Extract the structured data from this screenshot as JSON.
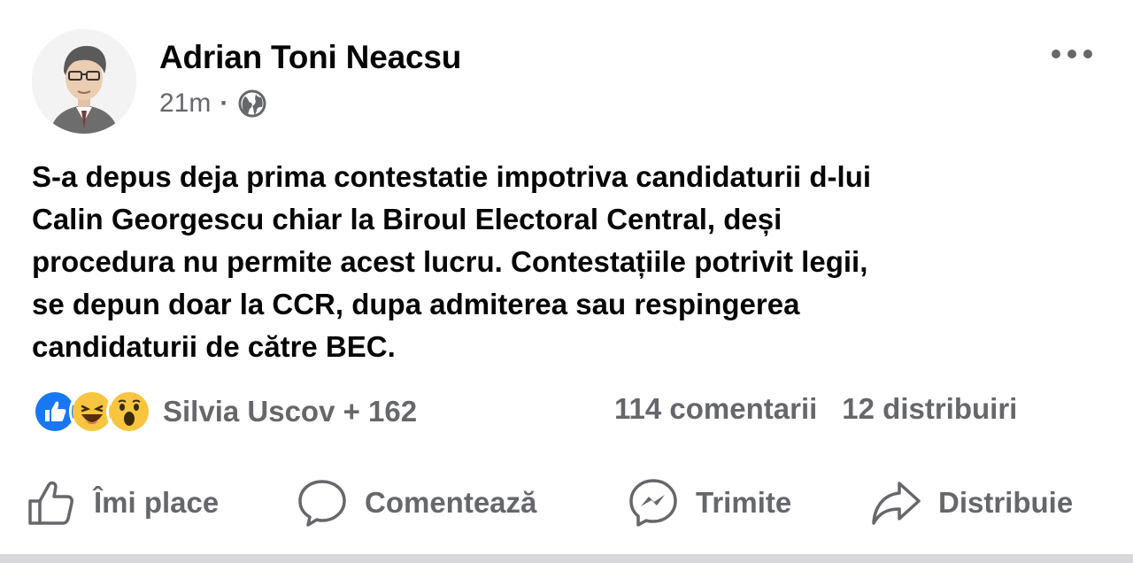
{
  "post": {
    "author": "Adrian Toni Neacsu",
    "time": "21m",
    "separator": "·",
    "audience_icon": "globe-icon",
    "body_lines": [
      "S-a depus deja prima contestatie impotriva candidaturii d-lui",
      "Calin Georgescu chiar la Biroul Electoral Central, deși",
      "procedura nu permite acest lucru. Contestațiile potrivit legii,",
      "se depun doar la CCR, dupa admiterea sau respingerea",
      "candidaturii de către BEC."
    ]
  },
  "reactions": {
    "icons": [
      "like-icon",
      "haha-icon",
      "wow-icon"
    ],
    "summary": "Silvia Uscov + 162"
  },
  "stats": {
    "comments": "114 comentarii",
    "shares": "12 distribuiri"
  },
  "actions": {
    "like": "Îmi place",
    "comment": "Comentează",
    "send": "Trimite",
    "share": "Distribuie"
  },
  "colors": {
    "text": "#050505",
    "secondary": "#65676b",
    "like_blue": "#1877f2",
    "emoji_yellow": "#f7c53f"
  }
}
